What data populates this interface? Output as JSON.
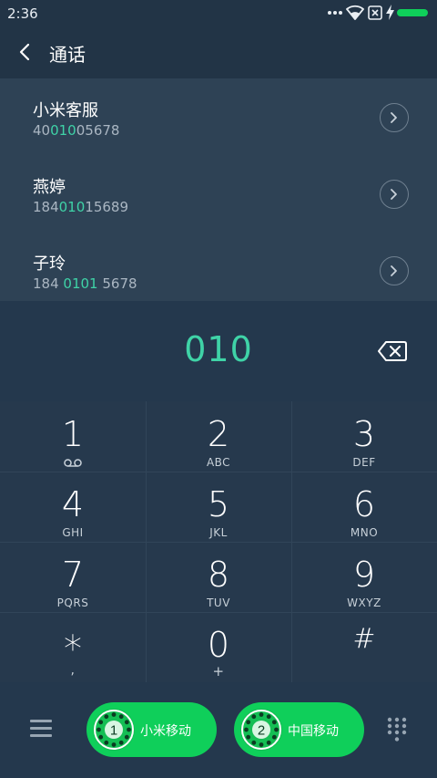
{
  "status_bar": {
    "time": "2:36"
  },
  "header": {
    "title": "通话"
  },
  "contacts": [
    {
      "name": "小米客服",
      "number_pre": "40",
      "number_match": "010",
      "number_post": "05678"
    },
    {
      "name": "燕婷",
      "number_pre": "184",
      "number_match": "010",
      "number_post": "15689"
    },
    {
      "name": "子玲",
      "number_pre": "184 ",
      "number_match": "0101",
      "number_post": " 5678"
    }
  ],
  "dial": {
    "number": "010"
  },
  "keypad": [
    {
      "digit": "1",
      "sub": ""
    },
    {
      "digit": "2",
      "sub": "ABC"
    },
    {
      "digit": "3",
      "sub": "DEF"
    },
    {
      "digit": "4",
      "sub": "GHI"
    },
    {
      "digit": "5",
      "sub": "JKL"
    },
    {
      "digit": "6",
      "sub": "MNO"
    },
    {
      "digit": "7",
      "sub": "PQRS"
    },
    {
      "digit": "8",
      "sub": "TUV"
    },
    {
      "digit": "9",
      "sub": "WXYZ"
    },
    {
      "digit": "*",
      "sub": ","
    },
    {
      "digit": "0",
      "sub": "+"
    },
    {
      "digit": "#",
      "sub": ""
    }
  ],
  "sim": [
    {
      "slot": "1",
      "label": "小米移动"
    },
    {
      "slot": "2",
      "label": "中国移动"
    }
  ],
  "icons": {
    "status": [
      "more-dots-icon",
      "wifi-icon",
      "no-sim-icon",
      "charging-bolt-icon",
      "battery-icon"
    ],
    "voicemail": "voicemail-icon",
    "backspace": "backspace-icon"
  },
  "colors": {
    "accent": "#3fd3a7",
    "call_button": "#0fcf5a",
    "background": "#24384d"
  }
}
